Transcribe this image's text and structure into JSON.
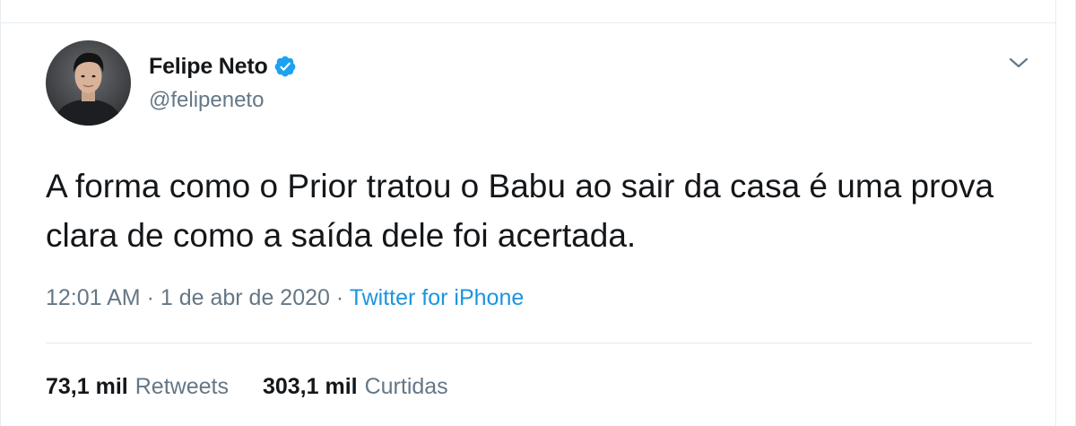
{
  "tweet": {
    "author": {
      "display_name": "Felipe Neto",
      "handle": "@felipeneto",
      "verified": true,
      "avatar_icon": "profile-photo"
    },
    "text": "A forma como o Prior tratou o Babu ao sair da casa é uma prova clara de como a saída dele foi acertada.",
    "time": "12:01 AM",
    "separator": "·",
    "date": "1 de abr de 2020",
    "source": "Twitter for iPhone",
    "stats": [
      {
        "count": "73,1 mil",
        "label": "Retweets"
      },
      {
        "count": "303,1 mil",
        "label": "Curtidas"
      }
    ],
    "menu_icon": "chevron-down-icon"
  },
  "colors": {
    "text_primary": "#14171a",
    "text_secondary": "#657786",
    "link": "#1b95e0",
    "verified_badge": "#1da1f2",
    "divider": "#e6ecf0"
  }
}
